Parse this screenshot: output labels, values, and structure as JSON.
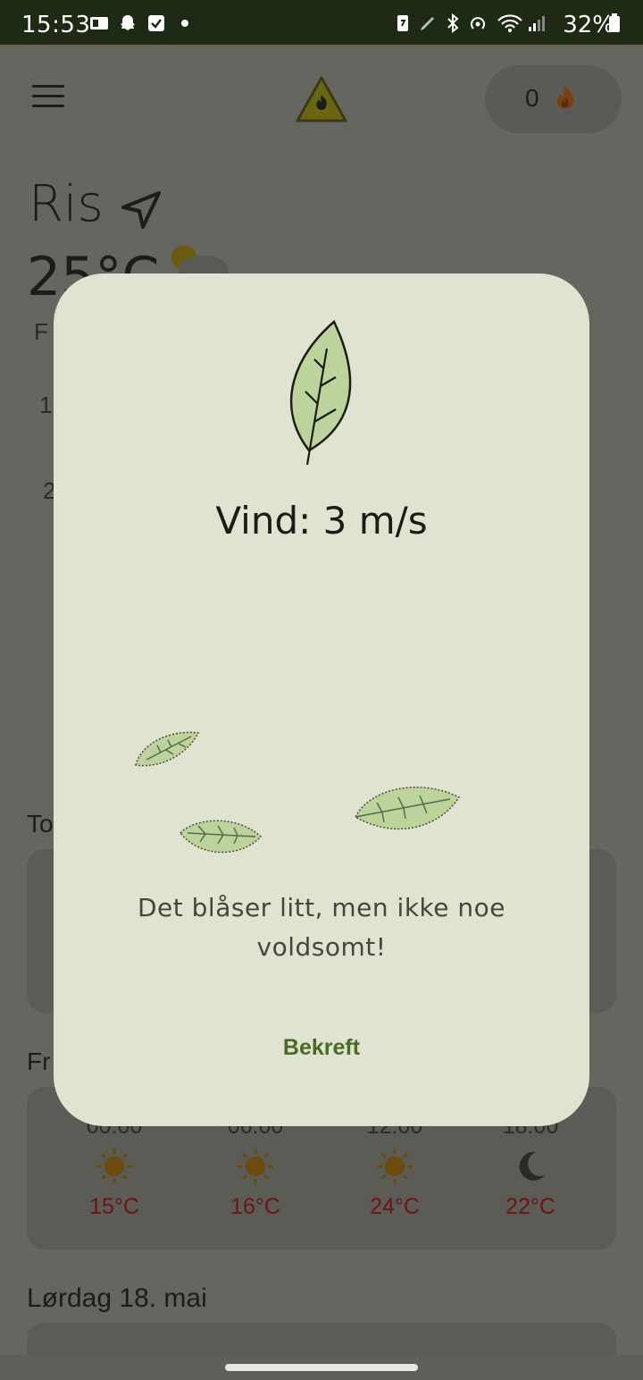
{
  "status_bar": {
    "time": "15:53",
    "battery": "32%"
  },
  "header": {
    "fire_count": "0"
  },
  "location": {
    "city": "Ris",
    "temperature": "25°C",
    "desc_fragment": "F",
    "row1_fragment": "1",
    "row2_fragment": "2"
  },
  "sections": {
    "today_fragment": "To",
    "friday_fragment": "Fr",
    "saturday_label": "Lørdag 18. mai"
  },
  "hourly": [
    {
      "time": "00:00",
      "icon": "sun-icon",
      "temp": "15°C"
    },
    {
      "time": "06:00",
      "icon": "sun-icon",
      "temp": "16°C"
    },
    {
      "time": "12:00",
      "icon": "sun-icon",
      "temp": "24°C"
    },
    {
      "time": "18:00",
      "icon": "moon-icon",
      "temp": "22°C"
    }
  ],
  "dialog": {
    "title": "Vind: 3 m/s",
    "message": "Det blåser litt, men ikke noe voldsomt!",
    "confirm_label": "Bekreft"
  },
  "colors": {
    "dialog_bg": "#e1e3d1",
    "accent": "#4b6b24",
    "scrim": "#5e5f58"
  }
}
